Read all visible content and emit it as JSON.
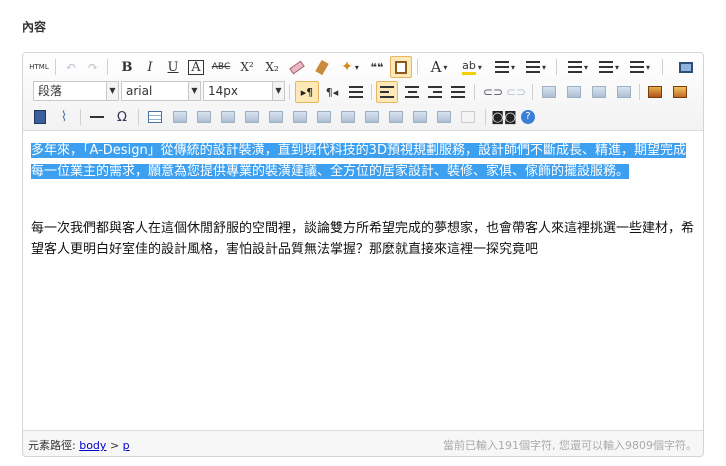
{
  "section": {
    "title": "內容"
  },
  "toolbar": {
    "html_label": "HTML",
    "bold": "B",
    "italic": "I",
    "underline": "U",
    "font_border": "A",
    "strike": "ABC",
    "superscript": "X²",
    "subscript": "X₂",
    "quote": "❝❝",
    "forecolor": "A",
    "symbol": "Ω",
    "paragraph_value": "段落",
    "fontfamily_value": "arial",
    "fontsize_value": "14px",
    "ltr": "▸¶",
    "rtl": "¶◂"
  },
  "content": {
    "para1": "多年來，「A-Design」從傳統的設計裝潢，直到現代科技的3D預視規劃服務，設計師們不斷成長、精進，期望完成每一位業主的需求，願意為您提供專業的裝潢建議、全方位的居家設計、裝修、家俱、傢飾的擺設服務。",
    "para2": "每一次我們都與客人在這個休閒舒服的空間裡，談論雙方所希望完成的夢想家，也會帶客人來這裡挑選一些建材，希望客人更明白好室佳的設計風格，害怕設計品質無法掌握？那麼就直接來這裡一探究竟吧"
  },
  "statusbar": {
    "path_label": "元素路徑:",
    "path_body": "body",
    "path_sep": ">",
    "path_p": "p",
    "count_text": "當前已輸入191個字符, 您還可以輸入9809個字符。"
  },
  "colors": {
    "selection": "#3c9ff0",
    "active_button": "#fde8b8"
  }
}
